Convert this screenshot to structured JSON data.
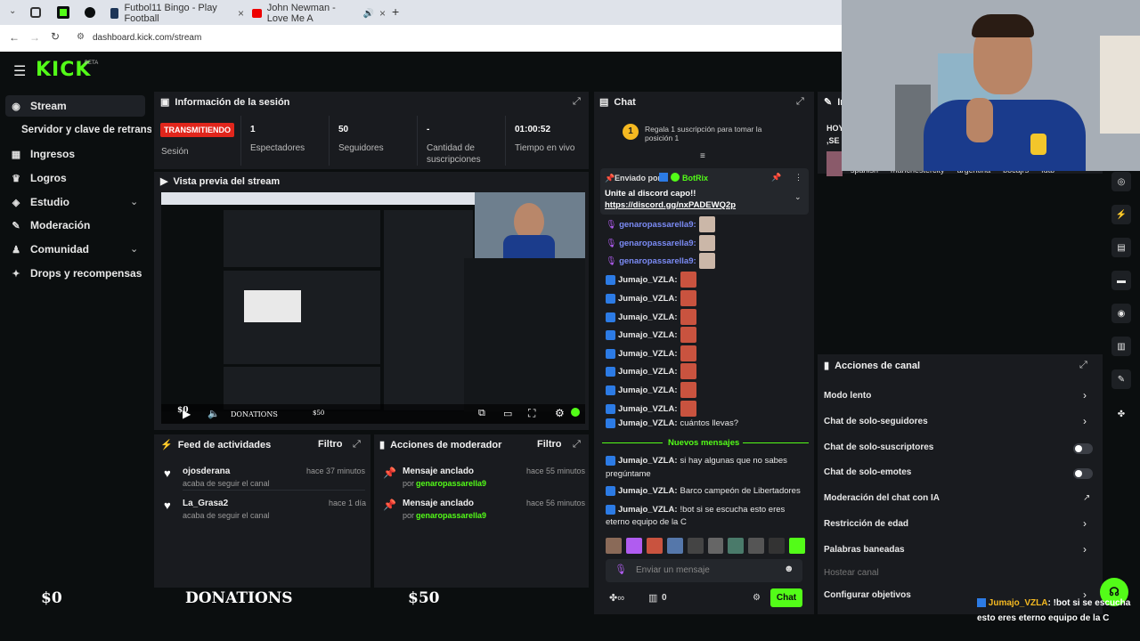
{
  "browser": {
    "tabs": [
      {
        "label": "Futbol11 Bingo - Play Football"
      },
      {
        "label": "John Newman - Love Me A"
      }
    ],
    "url": "dashboard.kick.com/stream"
  },
  "header": {
    "logo": "KICK",
    "beta": "BETA"
  },
  "sidebar": {
    "items": [
      {
        "label": "Stream"
      },
      {
        "label": "Servidor y clave de retransm"
      },
      {
        "label": "Ingresos"
      },
      {
        "label": "Logros"
      },
      {
        "label": "Estudio"
      },
      {
        "label": "Moderación"
      },
      {
        "label": "Comunidad"
      },
      {
        "label": "Drops y recompensas"
      }
    ]
  },
  "session": {
    "title": "Información de la sesión",
    "status_badge": "TRANSMITIENDO",
    "status_label": "Sesión",
    "stats": [
      {
        "value": "1",
        "label": "Espectadores"
      },
      {
        "value": "50",
        "label": "Seguidores"
      },
      {
        "value": "-",
        "label": "Cantidad de suscripciones"
      },
      {
        "value": "01:00:52",
        "label": "Tiempo en vivo"
      }
    ]
  },
  "preview": {
    "title": "Vista previa del stream",
    "overlay_left": "$0",
    "overlay_mid": "DONATIONS",
    "overlay_right": "$50"
  },
  "activity": {
    "title": "Feed de actividades",
    "filter": "Filtro",
    "items": [
      {
        "name": "ojosderana",
        "sub": "acaba de seguir el canal",
        "time": "hace 37 minutos"
      },
      {
        "name": "La_Grasa2",
        "sub": "acaba de seguir el canal",
        "time": "hace 1 día"
      }
    ]
  },
  "modactions": {
    "title": "Acciones de moderador",
    "filter": "Filtro",
    "items": [
      {
        "name": "Mensaje anclado",
        "by_prefix": "por",
        "by": "genaropassarella9",
        "time": "hace 55 minutos"
      },
      {
        "name": "Mensaje anclado",
        "by_prefix": "por",
        "by": "genaropassarella9",
        "time": "hace 56 minutos"
      }
    ]
  },
  "chat": {
    "title": "Chat",
    "gift_count": "1",
    "gift_text": "Regala 1 suscripción para tomar la posición 1",
    "pinned_prefix": "Enviado por",
    "pinned_user": "BotRix",
    "pinned_text": "Unite al discord capo!!",
    "pinned_link": "https://discord.gg/nxPADEWQ2p",
    "messages": [
      {
        "user": "genaropassarella9:",
        "text": ""
      },
      {
        "user": "genaropassarella9:",
        "text": ""
      },
      {
        "user": "genaropassarella9:",
        "text": ""
      },
      {
        "user": "Jumajo_VZLA:",
        "text": ""
      },
      {
        "user": "Jumajo_VZLA:",
        "text": ""
      },
      {
        "user": "Jumajo_VZLA:",
        "text": ""
      },
      {
        "user": "Jumajo_VZLA:",
        "text": ""
      },
      {
        "user": "Jumajo_VZLA:",
        "text": ""
      },
      {
        "user": "Jumajo_VZLA:",
        "text": ""
      },
      {
        "user": "Jumajo_VZLA:",
        "text": ""
      },
      {
        "user": "Jumajo_VZLA:",
        "text": ""
      },
      {
        "user": "Jumajo_VZLA:",
        "text": "cuántos llevas?"
      }
    ],
    "new_messages_label": "Nuevos mensajes",
    "new_messages": [
      {
        "user": "Jumajo_VZLA:",
        "text": "si hay algunas que no sabes",
        "text2": "pregúntame"
      },
      {
        "user": "Jumajo_VZLA:",
        "text": "Barco campeón de Libertadores",
        "text2": ""
      },
      {
        "user": "Jumajo_VZLA:",
        "text": "!bot si se escucha esto eres",
        "text2": "eterno equipo de la C"
      }
    ],
    "input_placeholder": "Enviar un mensaje",
    "points": "0",
    "send_button": "Chat"
  },
  "right_panel": {
    "title": "Acciones de canal",
    "partial_title": "In",
    "tags": [
      "spanish",
      "manchestercity",
      "argentina",
      "bocajrs",
      "futb"
    ],
    "partial_text1": "HOY",
    "partial_text2": ",SE",
    "settings": [
      {
        "label": "Modo lento",
        "control": "arrow"
      },
      {
        "label": "Chat de solo-seguidores",
        "control": "arrow"
      },
      {
        "label": "Chat de solo-suscriptores",
        "control": "toggle"
      },
      {
        "label": "Chat de solo-emotes",
        "control": "toggle"
      },
      {
        "label": "Moderación del chat con IA",
        "control": "external"
      },
      {
        "label": "Restricción de edad",
        "control": "arrow"
      },
      {
        "label": "Palabras baneadas",
        "control": "arrow"
      },
      {
        "label": "Hostear canal",
        "control": "none"
      },
      {
        "label": "Configurar objetivos",
        "control": "arrow"
      }
    ]
  },
  "overlay": {
    "left": "$0",
    "middle": "DONATIONS",
    "right": "$50",
    "chat_user": "Jumajo_VZLA",
    "chat_sep": ":",
    "chat_text": "!bot si se escucha esto eres eterno equipo de la C"
  },
  "colors": {
    "accent": "#53fc18",
    "panel": "#191b1f",
    "bg": "#0b0e0f",
    "badge": "#e1261c"
  }
}
